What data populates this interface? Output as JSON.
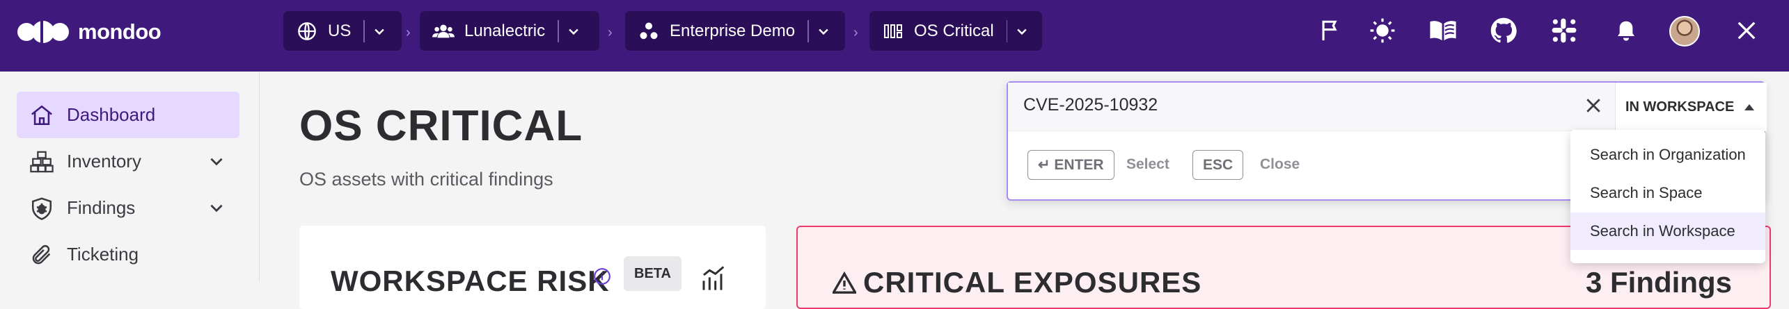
{
  "app": {
    "logo_text": "mondoo",
    "accent": "#3f1a7c"
  },
  "breadcrumbs": [
    {
      "label": "US",
      "icon": "globe-icon"
    },
    {
      "label": "Lunalectric",
      "icon": "users-icon"
    },
    {
      "label": "Enterprise Demo",
      "icon": "space-icon"
    },
    {
      "label": "OS Critical",
      "icon": "workspace-icon"
    }
  ],
  "breadcrumb_separator": "›",
  "topbar_icons": [
    "flag-icon",
    "sun-icon",
    "book-icon",
    "github-icon",
    "slack-icon",
    "bell-icon",
    "avatar",
    "close-icon"
  ],
  "sidebar": {
    "items": [
      {
        "label": "Dashboard",
        "icon": "home-icon",
        "active": true
      },
      {
        "label": "Inventory",
        "icon": "inventory-icon",
        "expandable": true
      },
      {
        "label": "Findings",
        "icon": "bug-shield-icon",
        "expandable": true
      },
      {
        "label": "Ticketing",
        "icon": "paperclip-icon"
      }
    ]
  },
  "main": {
    "title": "OS CRITICAL",
    "subtitle": "OS assets with critical findings",
    "cards": {
      "workspace_risk": {
        "title": "WORKSPACE RISK",
        "badge": "BETA"
      },
      "critical_exposures": {
        "title": "CRITICAL EXPOSURES",
        "count": "3 Findings",
        "border_color": "#ee3a6d"
      }
    }
  },
  "search": {
    "value": "CVE-2025-10932",
    "scope_label": "IN WORKSPACE",
    "hints": [
      {
        "key": "↵ ENTER",
        "label": "Select"
      },
      {
        "key": "ESC",
        "label": "Close"
      }
    ],
    "scope_options": [
      {
        "label": "Search in Organization"
      },
      {
        "label": "Search in Space"
      },
      {
        "label": "Search in Workspace",
        "selected": true
      }
    ]
  }
}
